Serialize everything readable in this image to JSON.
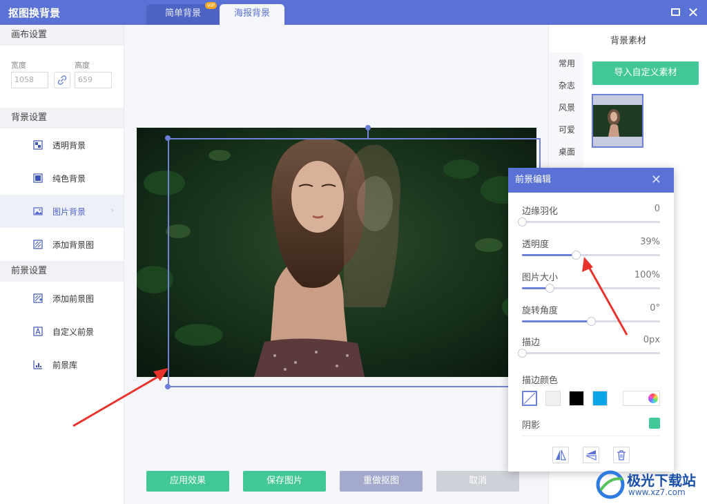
{
  "app": {
    "title": "抠图换背景"
  },
  "tabs": [
    {
      "label": "简单背景",
      "badge": "VIP"
    },
    {
      "label": "海报背景"
    }
  ],
  "sidebar": {
    "canvas_header": "画布设置",
    "width_label": "宽度",
    "width_value": "1058",
    "height_label": "高度",
    "height_value": "659",
    "background_header": "背景设置",
    "background_items": [
      {
        "label": "透明背景"
      },
      {
        "label": "纯色背景"
      },
      {
        "label": "图片背景"
      },
      {
        "label": "添加背景图"
      }
    ],
    "foreground_header": "前景设置",
    "foreground_items": [
      {
        "label": "添加前景图"
      },
      {
        "label": "自定义前景"
      },
      {
        "label": "前景库"
      }
    ]
  },
  "actions": {
    "apply": "应用效果",
    "save": "保存图片",
    "redo": "重做抠图",
    "cancel": "取消"
  },
  "right_panel": {
    "title": "背景素材",
    "categories": [
      "常用",
      "杂志",
      "风景",
      "可爱",
      "桌面"
    ],
    "import_button": "导入自定义素材"
  },
  "dialog": {
    "title": "前景编辑",
    "sliders": [
      {
        "label": "边缘羽化",
        "value": "0",
        "fraction": 0.0
      },
      {
        "label": "透明度",
        "value": "39%",
        "fraction": 0.39
      },
      {
        "label": "图片大小",
        "value": "100%",
        "fraction": 0.2
      },
      {
        "label": "旋转角度",
        "value": "0°",
        "fraction": 0.5
      },
      {
        "label": "描边",
        "value": "0px",
        "fraction": 0.0
      }
    ],
    "stroke_color_label": "描边颜色",
    "stroke_colors": [
      "#ffffff",
      "#f0f0f0",
      "#000000",
      "#0aa5e8"
    ],
    "shadow_label": "阴影",
    "accent_color": "#41c896"
  },
  "watermark": {
    "name": "极光下载站",
    "url": "www.xz7.com"
  }
}
